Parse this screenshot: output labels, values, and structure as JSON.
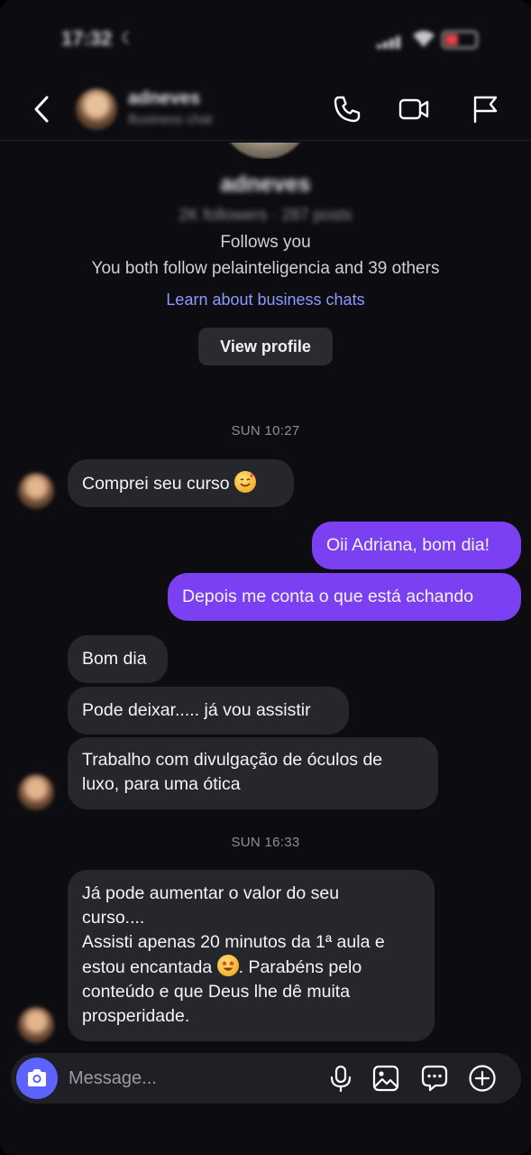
{
  "status_bar": {
    "time": "17:32"
  },
  "header": {
    "name": "adneves",
    "subtitle": "Business chat"
  },
  "profile": {
    "username": "adneves",
    "stats": "2K followers · 287 posts",
    "follows_you": "Follows you",
    "mutual": "You both follow pelainteligencia and 39 others",
    "learn_link": "Learn about business chats",
    "view_profile_label": "View profile"
  },
  "chat": {
    "timestamp_1": "SUN 10:27",
    "timestamp_2": "SUN 16:33",
    "messages": [
      {
        "from": "them",
        "text": "Comprei seu curso"
      },
      {
        "from": "me",
        "text": "Oii Adriana, bom dia!"
      },
      {
        "from": "me",
        "text": "Depois me conta o que está achando"
      },
      {
        "from": "them",
        "text": "Bom dia"
      },
      {
        "from": "them",
        "text": "Pode deixar..... já vou assistir"
      },
      {
        "from": "them",
        "line1": "Trabalho com divulgação de óculos de",
        "line2": "luxo, para uma ótica"
      },
      {
        "from": "them",
        "line1": "Já pode aumentar o valor do seu",
        "line2": "curso....",
        "line3": "Assisti apenas 20 minutos da 1ª aula e",
        "line4a": "estou encantada",
        "line4b": ". Parabéns pelo",
        "line5": "conteúdo e que Deus lhe dê muita",
        "line6": "prosperidade."
      }
    ]
  },
  "composer": {
    "placeholder": "Message..."
  },
  "colors": {
    "background": "#0d0d11",
    "outgoing_bubble": "#7b40f2",
    "incoming_bubble": "#26272c",
    "link": "#8a9aff",
    "camera_button": "#5c63ff"
  },
  "icons": [
    "back-icon",
    "phone-icon",
    "video-icon",
    "flag-icon",
    "camera-icon",
    "mic-icon",
    "gallery-icon",
    "sticker-icon",
    "plus-icon"
  ]
}
